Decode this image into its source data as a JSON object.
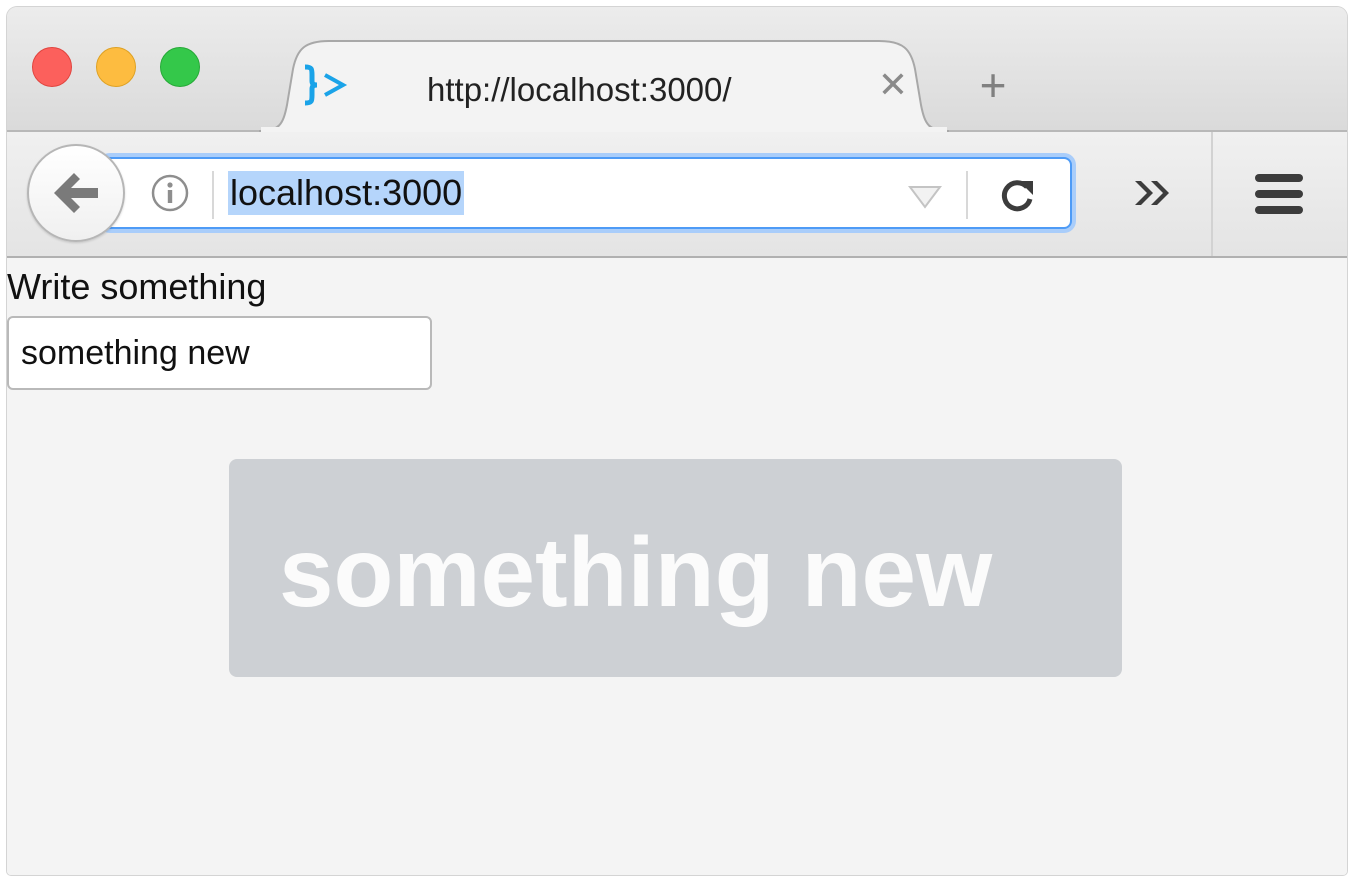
{
  "window": {
    "controls": [
      "close",
      "minimize",
      "maximize"
    ]
  },
  "tabs": [
    {
      "title": "http://localhost:3000/",
      "favicon": "bracket-arrow-icon",
      "favicon_color": "#1aa3e8",
      "active": true,
      "close_glyph": "✕"
    }
  ],
  "new_tab_glyph": "+",
  "toolbar": {
    "back_icon": "arrow-left-icon",
    "site_info_icon": "info-icon",
    "url": "localhost:3000",
    "url_selected": true,
    "history_dropdown_icon": "triangle-down-icon",
    "reload_icon": "reload-icon",
    "overflow_icon": "double-chevron-right-icon",
    "menu_icon": "hamburger-icon",
    "focus_color": "#4e9bf6"
  },
  "page": {
    "label": "Write something",
    "input_value": "something new",
    "echo_text": "something new",
    "echo_background": "#cdd0d4"
  }
}
